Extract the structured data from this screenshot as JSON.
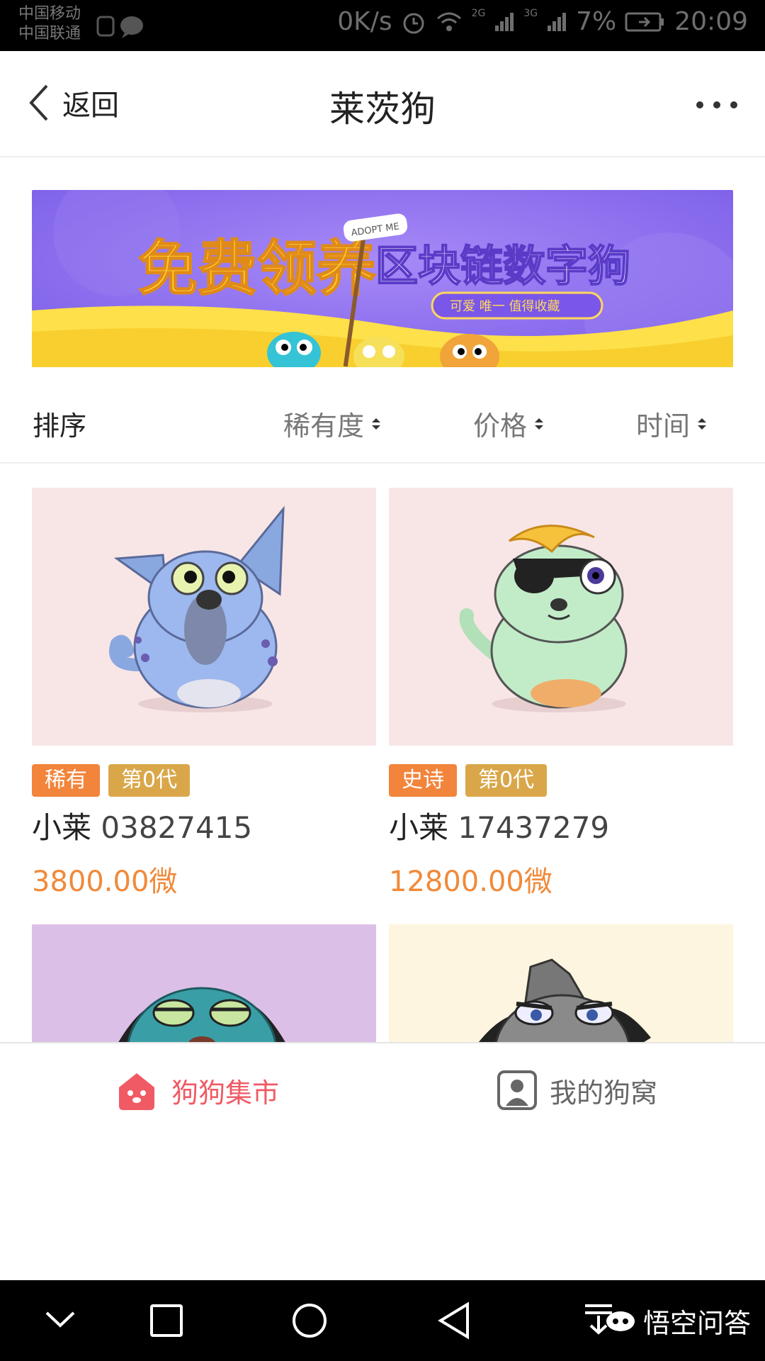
{
  "statusbar": {
    "carrier1": "中国移动",
    "carrier2": "中国联通",
    "net_speed": "0K/s",
    "sig1": "2G",
    "sig2": "3G",
    "battery": "7%",
    "time": "20:09"
  },
  "nav": {
    "back_label": "返回",
    "title": "莱茨狗",
    "more": "···"
  },
  "banner": {
    "headline_a": "免费领养",
    "headline_b": "区块链数字狗",
    "sign": "ADOPT ME",
    "tagline": "可爱 唯一 值得收藏"
  },
  "sort": {
    "label": "排序",
    "options": [
      "稀有度",
      "价格",
      "时间"
    ]
  },
  "dogs": [
    {
      "rarity": "稀有",
      "generation": "第0代",
      "name": "小莱",
      "id": "03827415",
      "price": "3800.00微",
      "bg": "#f8e6e6"
    },
    {
      "rarity": "史诗",
      "generation": "第0代",
      "name": "小莱",
      "id": "17437279",
      "price": "12800.00微",
      "bg": "#f8e6e6"
    },
    {
      "bg": "#dcbfe6"
    },
    {
      "bg": "#fdf5df"
    }
  ],
  "tabs": [
    {
      "label": "狗狗集市",
      "active": true,
      "color": "#f05a64"
    },
    {
      "label": "我的狗窝",
      "active": false,
      "color": "#666666"
    }
  ],
  "watermark": "悟空问答",
  "colors": {
    "rarity_tag": "#f2843b",
    "generation_tag": "#d9a74a",
    "price": "#f08a3a",
    "banner_bg": "#8b6ef0"
  }
}
